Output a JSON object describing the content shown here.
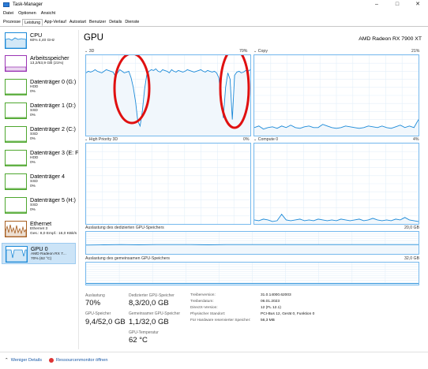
{
  "window": {
    "title": "Task-Manager",
    "minimize": "–",
    "maximize": "□",
    "close": "✕"
  },
  "menu": [
    "Datei",
    "Optionen",
    "Ansicht"
  ],
  "tabs": [
    "Prozesse",
    "Leistung",
    "App-Verlauf",
    "Autostart",
    "Benutzer",
    "Details",
    "Dienste"
  ],
  "active_tab": "Leistung",
  "sidebar": [
    {
      "name": "CPU",
      "lines": [
        "60% 4,40 GHz"
      ],
      "color": "#1c8ad8"
    },
    {
      "name": "Arbeitsspeicher",
      "lines": [
        "13,2/63,9 GB (21%)"
      ],
      "color": "#9b35b5"
    },
    {
      "name": "Datenträger 0 (G:)",
      "lines": [
        "HDD",
        "0%"
      ],
      "color": "#4ea72e"
    },
    {
      "name": "Datenträger 1 (D:)",
      "lines": [
        "SSD",
        "0%"
      ],
      "color": "#4ea72e"
    },
    {
      "name": "Datenträger 2 (C:)",
      "lines": [
        "SSD",
        "0%"
      ],
      "color": "#4ea72e"
    },
    {
      "name": "Datenträger 3 (E: F",
      "lines": [
        "HDD",
        "0%"
      ],
      "color": "#4ea72e"
    },
    {
      "name": "Datenträger 4",
      "lines": [
        "SSD",
        "0%"
      ],
      "color": "#4ea72e"
    },
    {
      "name": "Datenträger 5 (H:)",
      "lines": [
        "SSD",
        "0%"
      ],
      "color": "#4ea72e"
    },
    {
      "name": "Ethernet",
      "lines": [
        "Ethernet 3",
        "Ges.: 8,0 Empf.: 16,0 KBit/s"
      ],
      "color": "#a75e20"
    },
    {
      "name": "GPU 0",
      "lines": [
        "AMD Radeon RX 7...",
        "70% (62 °C)"
      ],
      "color": "#1c8ad8"
    }
  ],
  "gpu": {
    "title": "GPU",
    "model": "AMD Radeon RX 7900 XT",
    "engines": [
      {
        "name": "3D",
        "value": "70%"
      },
      {
        "name": "Copy",
        "value": "21%"
      },
      {
        "name": "High Priority 3D",
        "value": "0%"
      },
      {
        "name": "Compute 0",
        "value": "4%"
      }
    ],
    "dedicated_label": "Auslastung des dedizierten GPU-Speichers",
    "dedicated_max": "20,0 GB",
    "shared_label": "Auslastung des gemeinsamen GPU-Speichers",
    "shared_max": "32,0 GB"
  },
  "stats": {
    "auslastung_label": "Auslastung",
    "auslastung": "70%",
    "gpu_speicher_label": "GPU-Speicher",
    "gpu_speicher": "9,4/52,0 GB",
    "dedicated_label": "Dedizierter GPU-Speicher",
    "dedicated": "8,3/20,0 GB",
    "shared_label": "Gemeinsamer GPU-Speicher",
    "shared": "1,1/32,0 GB",
    "temp_label": "GPU-Temperatur",
    "temp": "62 °C"
  },
  "info": [
    {
      "key": "Treiberversion:",
      "value": "31.0.14000.62003"
    },
    {
      "key": "Treiberdatum:",
      "value": "06.01.2023"
    },
    {
      "key": "DirectX-Version:",
      "value": "12 (FL 12.1)"
    },
    {
      "key": "Physischer Standort:",
      "value": "PCI-Bus 12, Gerät 0, Funktion 0"
    },
    {
      "key": "Für Hardware reservierter Speicher:",
      "value": "56,3 MB"
    }
  ],
  "footer": {
    "fewer_details": "Weniger Details",
    "resource_monitor": "Ressourcenmonitor öffnen"
  },
  "series": {
    "gpu3d": [
      0.78,
      0.8,
      0.79,
      0.8,
      0.82,
      0.8,
      0.79,
      0.78,
      0.8,
      0.82,
      0.81,
      0.8,
      0.79,
      0.74,
      0.78,
      0.82,
      0.8,
      0.78,
      0.79,
      0.8,
      0.72,
      0.6,
      0.42,
      0.18,
      0.12,
      0.3,
      0.58,
      0.76,
      0.8,
      0.82,
      0.81,
      0.83,
      0.8,
      0.79,
      0.82,
      0.81,
      0.8,
      0.78,
      0.82,
      0.8,
      0.79,
      0.81,
      0.8,
      0.79,
      0.8,
      0.82,
      0.81,
      0.8,
      0.79,
      0.8,
      0.81,
      0.82,
      0.8,
      0.79,
      0.81,
      0.8,
      0.79,
      0.8,
      0.78,
      0.72,
      0.48,
      0.22,
      0.6,
      0.78,
      0.7,
      0.2,
      0.75,
      0.79,
      0.8,
      0.78,
      0.79,
      0.81,
      0.8,
      0.82
    ],
    "copy": [
      0.1,
      0.12,
      0.08,
      0.1,
      0.11,
      0.09,
      0.12,
      0.1,
      0.13,
      0.1,
      0.09,
      0.11,
      0.12,
      0.1,
      0.1,
      0.14,
      0.12,
      0.1,
      0.09,
      0.1,
      0.12,
      0.11,
      0.1,
      0.09,
      0.1,
      0.12,
      0.11,
      0.1,
      0.12,
      0.1,
      0.09,
      0.11,
      0.13,
      0.1,
      0.12,
      0.1,
      0.2
    ],
    "compute": [
      0.05,
      0.04,
      0.06,
      0.05,
      0.03,
      0.04,
      0.12,
      0.05,
      0.04,
      0.05,
      0.06,
      0.04,
      0.05,
      0.04,
      0.06,
      0.05,
      0.04,
      0.05,
      0.04,
      0.06,
      0.05,
      0.04,
      0.05,
      0.06,
      0.04,
      0.05,
      0.07,
      0.05,
      0.04,
      0.05,
      0.04,
      0.06,
      0.05,
      0.08,
      0.05,
      0.04,
      0.03
    ],
    "dedicated": [
      0.4,
      0.41,
      0.42,
      0.41,
      0.42,
      0.42,
      0.42,
      0.41,
      0.42,
      0.42,
      0.42,
      0.42,
      0.42,
      0.42,
      0.42,
      0.42,
      0.42,
      0.42,
      0.42,
      0.42
    ],
    "shared": [
      0.05,
      0.05,
      0.05,
      0.05,
      0.05,
      0.05,
      0.05,
      0.05,
      0.05,
      0.05,
      0.05,
      0.05,
      0.05,
      0.05,
      0.05,
      0.05,
      0.05,
      0.05,
      0.05,
      0.05
    ]
  }
}
